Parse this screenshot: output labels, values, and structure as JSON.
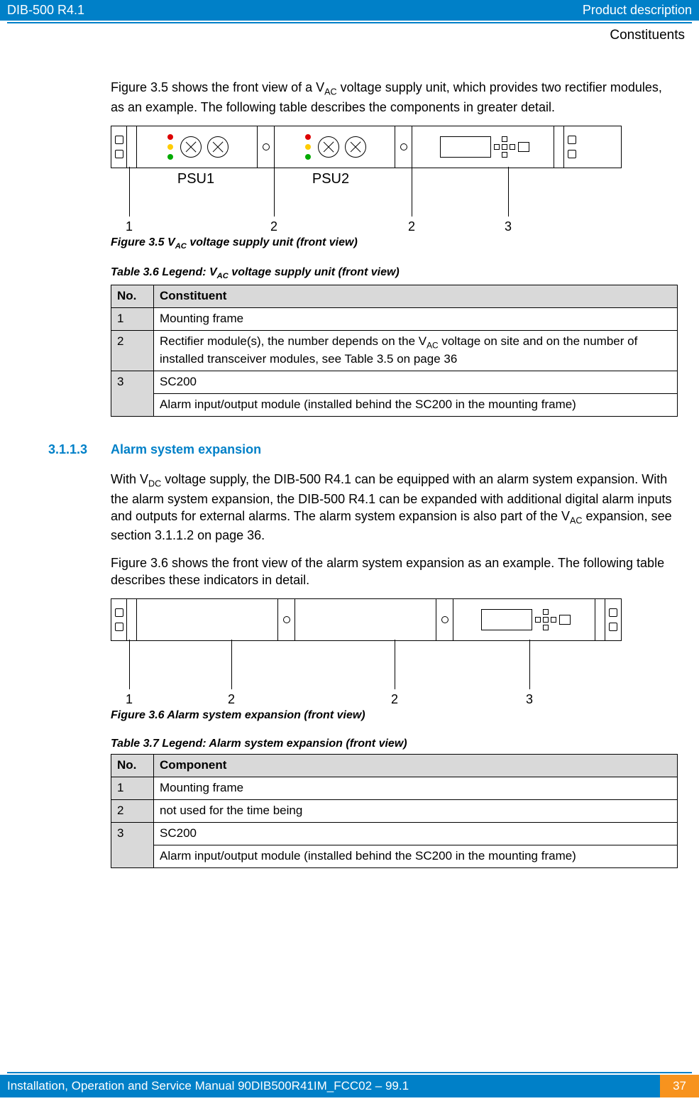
{
  "header": {
    "left": "DIB-500 R4.1",
    "right": "Product description"
  },
  "subhead": "Constituents",
  "para1_pre": "Figure 3.5 shows the front view of a V",
  "para1_sub": "AC",
  "para1_post": " voltage supply unit, which provides two rectifier modules, as an example. The following table describes the components in greater detail.",
  "fig1": {
    "psu1": "PSU1",
    "psu2": "PSU2",
    "c1": "1",
    "c2a": "2",
    "c2b": "2",
    "c3": "3",
    "caption_pre": "Figure 3.5    V",
    "caption_sub": "AC",
    "caption_post": " voltage supply unit (front view)"
  },
  "table1": {
    "caption_pre": "Table 3.6     Legend: V",
    "caption_sub": "AC",
    "caption_post": " voltage supply unit (front view)",
    "h1": "No.",
    "h2": "Constituent",
    "r1n": "1",
    "r1c": "Mounting frame",
    "r2n": "2",
    "r2c_pre": "Rectifier module(s), the number depends on the V",
    "r2c_sub": "AC",
    "r2c_post": " voltage on site and on the number of installed transceiver modules, see Table 3.5 on page 36",
    "r3n": "3",
    "r3c1": "SC200",
    "r3c2": "Alarm input/output module (installed behind the SC200 in the mounting frame)"
  },
  "section": {
    "num": "3.1.1.3",
    "title": "Alarm system expansion"
  },
  "para2_pre": "With V",
  "para2_sub1": "DC",
  "para2_mid": " voltage supply, the DIB-500 R4.1 can be equipped with an alarm system expansion. With the alarm system expansion, the DIB-500 R4.1 can be expanded with additional digital alarm inputs and outputs for external alarms. The alarm system expansion is also part of the V",
  "para2_sub2": "AC",
  "para2_post": " expansion, see section 3.1.1.2 on page 36.",
  "para3": "Figure 3.6 shows the front view of the alarm system expansion as an example. The following table describes these indicators in detail.",
  "fig2": {
    "c1": "1",
    "c2a": "2",
    "c2b": "2",
    "c3": "3",
    "caption": "Figure 3.6    Alarm system expansion (front view)"
  },
  "table2": {
    "caption": "Table 3.7     Legend: Alarm system expansion (front view)",
    "h1": "No.",
    "h2": "Component",
    "r1n": "1",
    "r1c": "Mounting frame",
    "r2n": "2",
    "r2c": "not used for the time being",
    "r3n": "3",
    "r3c1": "SC200",
    "r3c2": "Alarm input/output module (installed behind the SC200 in the mounting frame)"
  },
  "footer": {
    "left": "Installation, Operation and Service Manual 90DIB500R41IM_FCC02 – 99.1",
    "page": "37"
  }
}
